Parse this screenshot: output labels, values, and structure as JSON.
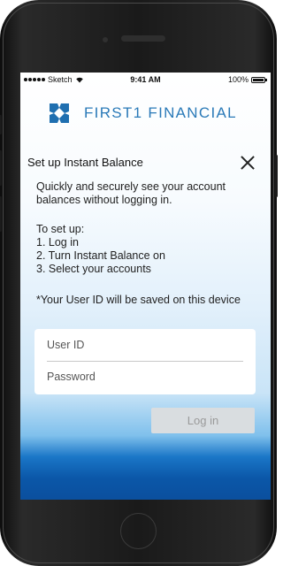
{
  "status_bar": {
    "carrier": "Sketch",
    "time": "9:41 AM",
    "battery": "100%"
  },
  "brand": {
    "name": "FIRST1 FINANCIAL",
    "logo_color": "#1f6fb0"
  },
  "dialog": {
    "title": "Set up Instant Balance",
    "description": "Quickly and securely see your account balances without logging in.",
    "steps_heading": "To set up:",
    "steps": [
      "1. Log in",
      "2. Turn Instant Balance on",
      "3. Select your accounts"
    ],
    "note": "*Your User ID will be saved on this device"
  },
  "form": {
    "user_id_placeholder": "User ID",
    "password_placeholder": "Password",
    "login_label": "Log in"
  },
  "colors": {
    "accent": "#2a7ab8",
    "button_disabled_bg": "#d9dde0",
    "button_disabled_text": "#9a9a9a"
  }
}
